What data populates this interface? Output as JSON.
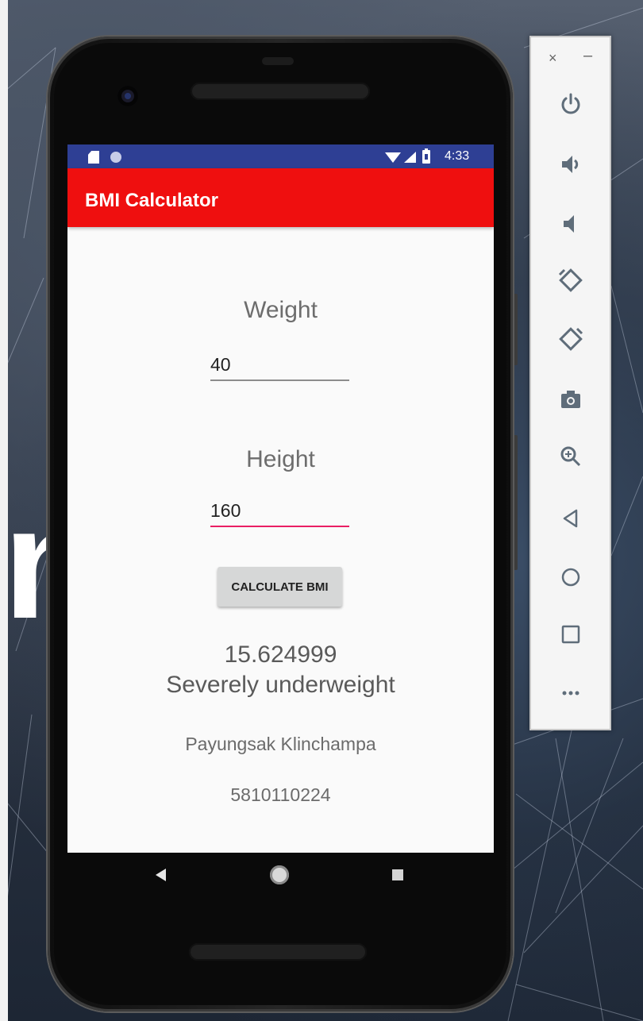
{
  "status_bar": {
    "time": "4:33"
  },
  "app_bar": {
    "title": "BMI Calculator"
  },
  "form": {
    "weight_label": "Weight",
    "weight_value": "40",
    "height_label": "Height",
    "height_value": "160",
    "calculate_label": "CALCULATE BMI"
  },
  "result": {
    "bmi_value": "15.624999",
    "category": "Severely underweight"
  },
  "footer": {
    "name": "Payungsak Klinchampa",
    "student_id": "5810110224"
  },
  "toolbar": {
    "close_label": "×",
    "minimize_label": "–",
    "icons": [
      "power-icon",
      "volume-up-icon",
      "volume-down-icon",
      "rotate-left-icon",
      "rotate-right-icon",
      "camera-icon",
      "zoom-icon",
      "back-icon",
      "home-icon",
      "overview-icon",
      "more-icon"
    ]
  },
  "background": {
    "big_letter": "n"
  },
  "colors": {
    "status_bar": "#2e3f94",
    "app_bar": "#ef0f0f",
    "accent": "#e91e63",
    "toolbar_icon": "#5f6d7a"
  }
}
